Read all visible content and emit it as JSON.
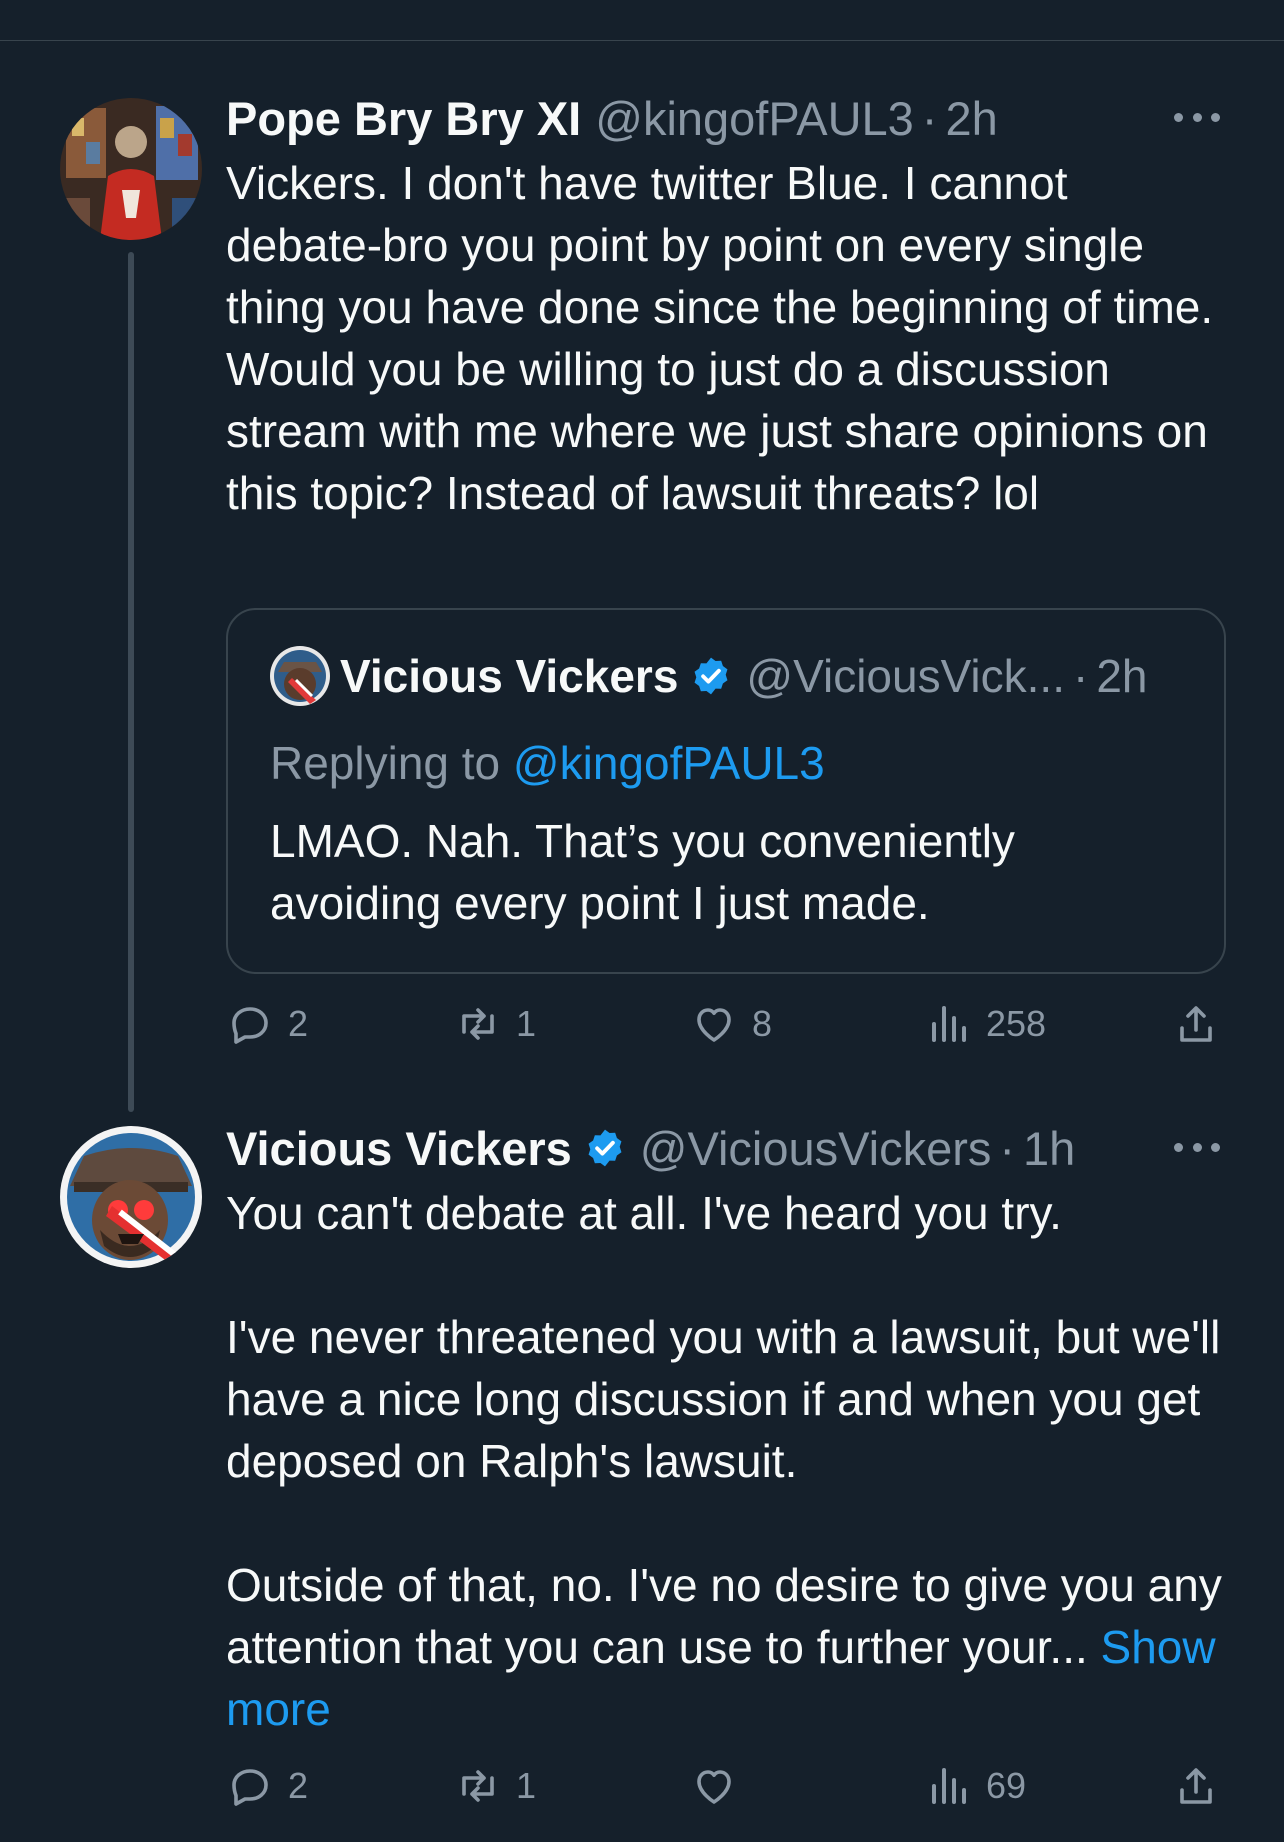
{
  "tweets": [
    {
      "author": "Pope Bry Bry XI",
      "handle": "@kingofPAUL3",
      "dot": "·",
      "time": "2h",
      "text": "Vickers. I don't have twitter Blue. I cannot debate-bro you point by point on every single thing you have done since the beginning of time. Would you be willing to just do a discussion stream with me where we just share opinions on this topic? Instead of lawsuit threats? lol",
      "quote": {
        "author": "Vicious Vickers",
        "handle": "@ViciousVick...",
        "dot": "·",
        "time": "2h",
        "replying_label": "Replying to",
        "replying_handle": "@kingofPAUL3",
        "text": "LMAO. Nah. That’s you conveniently avoiding every point I just made."
      },
      "stats": {
        "replies": "2",
        "retweets": "1",
        "likes": "8",
        "views": "258"
      }
    },
    {
      "author": "Vicious Vickers",
      "handle": "@ViciousVickers",
      "dot": "·",
      "time": "1h",
      "verified": true,
      "text_p1": "You can't debate at all. I've heard you try.",
      "text_p2": "I've never threatened you with a lawsuit, but we'll have a nice long discussion if and when you get deposed on Ralph's lawsuit.",
      "text_p3": "Outside of that, no. I've no desire to give you any attention that you can use to further your...",
      "show_more": "Show more",
      "stats": {
        "replies": "2",
        "retweets": "1",
        "likes": "",
        "views": "69"
      }
    }
  ],
  "icons": {
    "reply": "speech-bubble-icon",
    "retweet": "retweet-icon",
    "like": "heart-icon",
    "views": "bar-chart-icon",
    "share": "share-upload-icon",
    "verified": "verified-badge-icon",
    "more": "more-dots-icon"
  },
  "colors": {
    "background": "#15202b",
    "text": "#f7f9f9",
    "secondary": "#8b98a5",
    "accent": "#1d9bf0",
    "border": "#38444d"
  }
}
